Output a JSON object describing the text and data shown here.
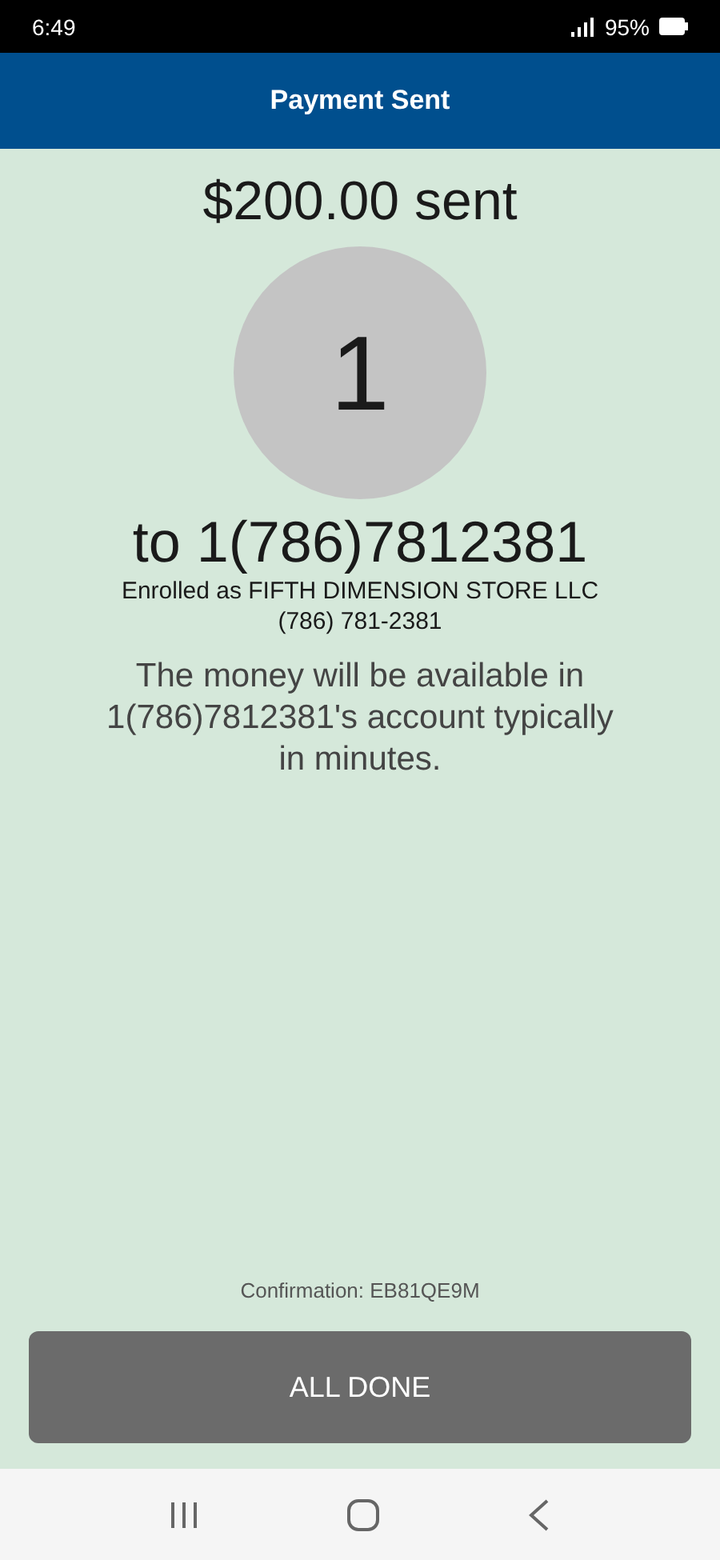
{
  "status_bar": {
    "time": "6:49",
    "battery": "95%"
  },
  "header": {
    "title": "Payment Sent"
  },
  "amount": "$200.00 sent",
  "avatar": {
    "initial": "1"
  },
  "recipient": "to 1(786)7812381",
  "enrolled": "Enrolled as FIFTH DIMENSION STORE LLC",
  "phone": "(786) 781-2381",
  "message": "The money will be available in 1(786)7812381's account typically in minutes.",
  "confirmation": "Confirmation: EB81QE9M",
  "button": {
    "label": "ALL DONE"
  }
}
